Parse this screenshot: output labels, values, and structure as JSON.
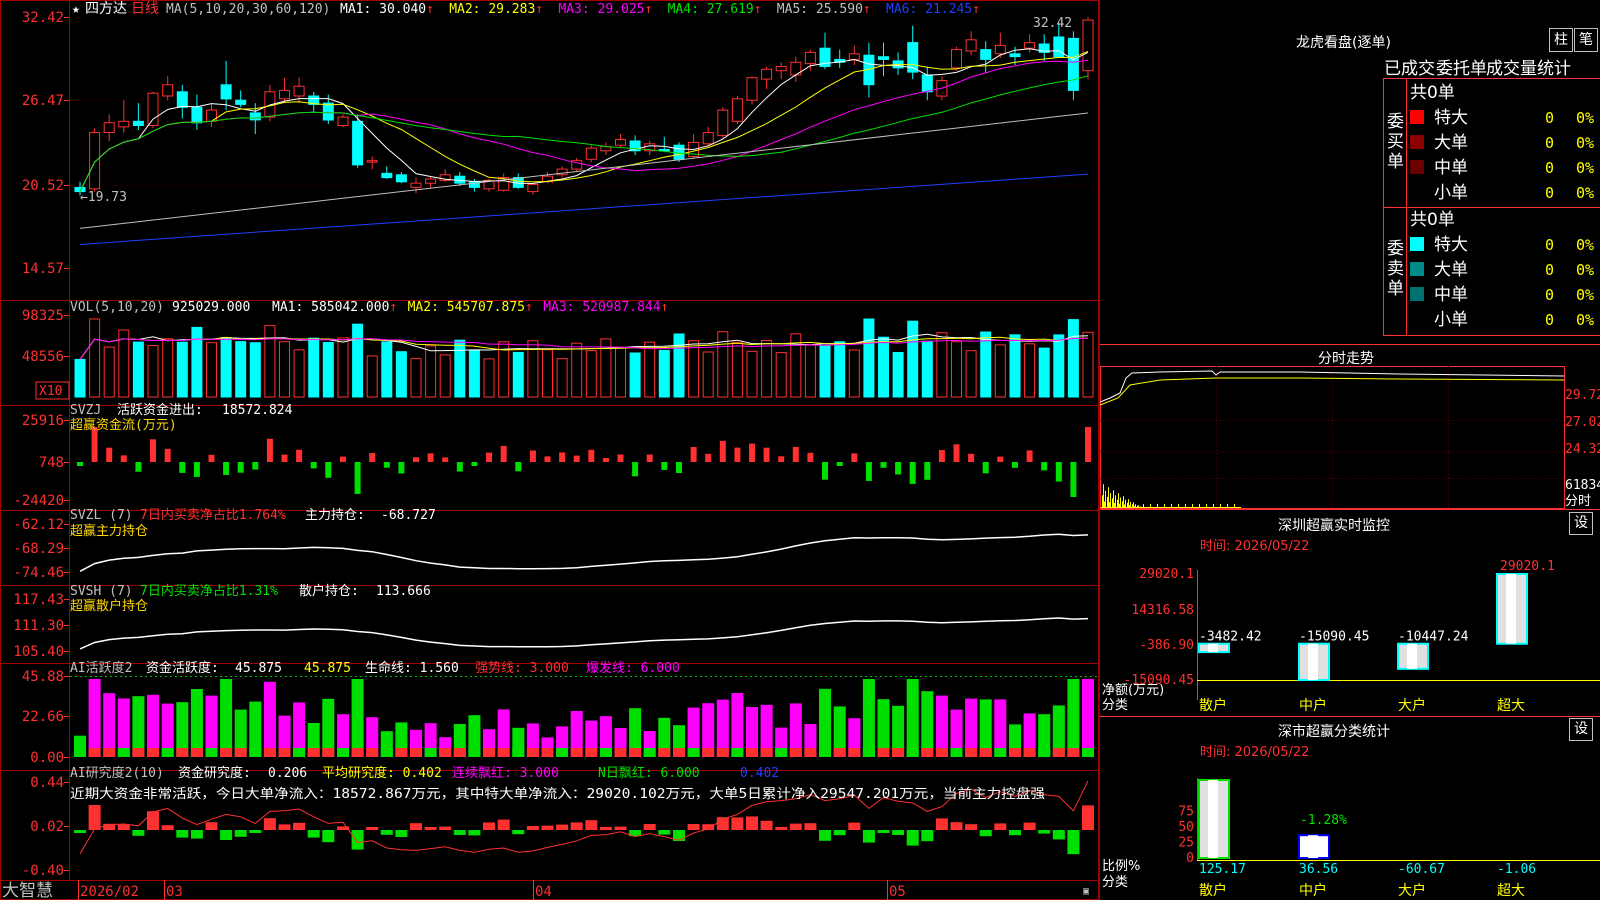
{
  "app": {
    "logo": "大智慧"
  },
  "kline": {
    "stock": "四方达",
    "period": "日线",
    "ma_header": "MA(5,10,20,30,60,120)",
    "mas": [
      {
        "label": "MA1:",
        "value": "30.040",
        "color": "#ffffff"
      },
      {
        "label": "MA2:",
        "value": "29.283",
        "color": "#ffff00"
      },
      {
        "label": "MA3:",
        "value": "29.025",
        "color": "#ff00ff"
      },
      {
        "label": "MA4:",
        "value": "27.619",
        "color": "#00e000"
      },
      {
        "label": "MA5:",
        "value": "25.590",
        "color": "#c0c0c0"
      },
      {
        "label": "MA6:",
        "value": "21.245",
        "color": "#2040ff"
      }
    ],
    "y_ticks": [
      "32.42",
      "26.47",
      "20.52",
      "14.57"
    ],
    "high_label": "32.42",
    "low_label": "19.73"
  },
  "vol": {
    "header": "VOL(5,10,20)",
    "value": "925029.000",
    "mas": [
      {
        "label": "MA1:",
        "value": "585042.000",
        "color": "#ffffff"
      },
      {
        "label": "MA2:",
        "value": "545707.875",
        "color": "#ffff00"
      },
      {
        "label": "MA3:",
        "value": "520987.844",
        "color": "#ff00ff"
      }
    ],
    "y_ticks": [
      "98325",
      "48556"
    ],
    "unit": "X10"
  },
  "svzj": {
    "name": "SVZJ",
    "label": "活跃资金进出:",
    "value": "18572.824",
    "subtitle": "超赢资金流(万元)",
    "y_ticks": [
      "25916",
      "748",
      "-24420"
    ]
  },
  "svzl": {
    "name": "SVZL",
    "param": "(7)",
    "ratio": "7日内买卖净占比1.764%",
    "label": "主力持仓:",
    "value": "-68.727",
    "subtitle": "超赢主力持仓",
    "y_ticks": [
      "-62.12",
      "-68.29",
      "-74.46"
    ]
  },
  "svsh": {
    "name": "SVSH",
    "param": "(7)",
    "ratio": "7日内买卖净占比1.31%",
    "label": "散户持仓:",
    "value": "113.666",
    "subtitle": "超赢散户持仓",
    "y_ticks": [
      "117.43",
      "111.30",
      "105.40"
    ]
  },
  "ai1": {
    "header": "AI活跃度2",
    "label": "资金活跃度:",
    "value": "45.875",
    "value2": "45.875",
    "life": "生命线: 1.560",
    "strong": "强势线: 3.000",
    "burst": "爆发线: 6.000",
    "y_ticks": [
      "45.88",
      "22.66",
      "0.00"
    ]
  },
  "ai2": {
    "header": "AI研究度2(10)",
    "label": "资金研究度:",
    "value": "0.206",
    "avg": "平均研究度: 0.402",
    "cont": "连续飘红: 3.000",
    "nday": "N日飘红: 6.000",
    "last": "0.402",
    "note": "近期大资金非常活跃，今日大单净流入：18572.867万元，其中特大单净流入：29020.102万元，大单5日累计净入29547.201万元，当前主力控盘强",
    "y_ticks": [
      "0.44",
      "0.02",
      "-0.40"
    ]
  },
  "x_axis": {
    "labels": [
      "2026/02",
      "03",
      "04",
      "05"
    ]
  },
  "chart_data": {
    "type": "candlestick",
    "price_range": [
      14.57,
      32.42
    ],
    "candles": [
      {
        "o": 20.3,
        "h": 20.7,
        "l": 19.73,
        "c": 20.0
      },
      {
        "o": 20.2,
        "h": 24.5,
        "l": 20.0,
        "c": 24.2
      },
      {
        "o": 24.2,
        "h": 25.5,
        "l": 23.6,
        "c": 24.9
      },
      {
        "o": 24.6,
        "h": 26.5,
        "l": 24.2,
        "c": 25.0
      },
      {
        "o": 25.0,
        "h": 26.3,
        "l": 24.4,
        "c": 24.7
      },
      {
        "o": 24.7,
        "h": 27.1,
        "l": 24.5,
        "c": 27.0
      },
      {
        "o": 26.8,
        "h": 28.2,
        "l": 26.5,
        "c": 27.6
      },
      {
        "o": 27.1,
        "h": 27.6,
        "l": 25.2,
        "c": 26.0
      },
      {
        "o": 26.0,
        "h": 26.9,
        "l": 24.4,
        "c": 24.9
      },
      {
        "o": 25.0,
        "h": 26.3,
        "l": 24.6,
        "c": 25.8
      },
      {
        "o": 27.6,
        "h": 29.3,
        "l": 25.8,
        "c": 26.6
      },
      {
        "o": 26.5,
        "h": 27.2,
        "l": 26.0,
        "c": 26.2
      },
      {
        "o": 25.6,
        "h": 26.3,
        "l": 24.1,
        "c": 25.1
      },
      {
        "o": 25.3,
        "h": 27.6,
        "l": 25.0,
        "c": 27.1
      },
      {
        "o": 26.6,
        "h": 28.1,
        "l": 26.4,
        "c": 27.2
      },
      {
        "o": 26.8,
        "h": 28.1,
        "l": 26.3,
        "c": 27.5
      },
      {
        "o": 26.8,
        "h": 27.1,
        "l": 25.6,
        "c": 26.2
      },
      {
        "o": 26.3,
        "h": 26.9,
        "l": 24.8,
        "c": 25.1
      },
      {
        "o": 24.7,
        "h": 25.5,
        "l": 24.6,
        "c": 25.3
      },
      {
        "o": 25.0,
        "h": 25.5,
        "l": 21.7,
        "c": 21.9
      },
      {
        "o": 22.1,
        "h": 22.5,
        "l": 21.6,
        "c": 22.2
      },
      {
        "o": 21.3,
        "h": 21.8,
        "l": 20.9,
        "c": 21.0
      },
      {
        "o": 21.2,
        "h": 21.4,
        "l": 20.6,
        "c": 20.7
      },
      {
        "o": 20.3,
        "h": 21.0,
        "l": 19.9,
        "c": 20.6
      },
      {
        "o": 20.6,
        "h": 21.1,
        "l": 20.2,
        "c": 20.9
      },
      {
        "o": 20.8,
        "h": 21.6,
        "l": 20.7,
        "c": 21.2
      },
      {
        "o": 21.1,
        "h": 21.4,
        "l": 20.4,
        "c": 20.6
      },
      {
        "o": 20.7,
        "h": 20.9,
        "l": 20.0,
        "c": 20.3
      },
      {
        "o": 20.2,
        "h": 20.9,
        "l": 20.0,
        "c": 20.8
      },
      {
        "o": 20.1,
        "h": 21.3,
        "l": 20.0,
        "c": 21.0
      },
      {
        "o": 21.0,
        "h": 21.3,
        "l": 20.2,
        "c": 20.3
      },
      {
        "o": 20.0,
        "h": 20.6,
        "l": 19.8,
        "c": 20.5
      },
      {
        "o": 20.7,
        "h": 21.4,
        "l": 20.6,
        "c": 21.1
      },
      {
        "o": 21.2,
        "h": 21.8,
        "l": 21.0,
        "c": 21.6
      },
      {
        "o": 21.6,
        "h": 22.4,
        "l": 21.4,
        "c": 22.2
      },
      {
        "o": 22.3,
        "h": 23.3,
        "l": 22.1,
        "c": 23.1
      },
      {
        "o": 22.9,
        "h": 23.5,
        "l": 22.6,
        "c": 23.2
      },
      {
        "o": 23.3,
        "h": 24.1,
        "l": 23.1,
        "c": 23.7
      },
      {
        "o": 23.6,
        "h": 24.0,
        "l": 22.6,
        "c": 22.9
      },
      {
        "o": 22.9,
        "h": 23.6,
        "l": 22.6,
        "c": 23.4
      },
      {
        "o": 23.0,
        "h": 23.9,
        "l": 22.8,
        "c": 22.9
      },
      {
        "o": 23.3,
        "h": 23.5,
        "l": 22.1,
        "c": 22.3
      },
      {
        "o": 22.5,
        "h": 24.1,
        "l": 22.4,
        "c": 23.5
      },
      {
        "o": 23.4,
        "h": 24.6,
        "l": 23.2,
        "c": 24.2
      },
      {
        "o": 24.0,
        "h": 26.0,
        "l": 23.8,
        "c": 25.8
      },
      {
        "o": 25.0,
        "h": 26.8,
        "l": 24.8,
        "c": 26.6
      },
      {
        "o": 26.5,
        "h": 28.2,
        "l": 26.2,
        "c": 28.1
      },
      {
        "o": 28.0,
        "h": 28.9,
        "l": 27.3,
        "c": 28.7
      },
      {
        "o": 28.6,
        "h": 29.2,
        "l": 28.0,
        "c": 28.9
      },
      {
        "o": 28.3,
        "h": 29.6,
        "l": 27.8,
        "c": 29.2
      },
      {
        "o": 29.1,
        "h": 30.1,
        "l": 28.6,
        "c": 29.9
      },
      {
        "o": 30.2,
        "h": 31.3,
        "l": 28.7,
        "c": 28.9
      },
      {
        "o": 29.4,
        "h": 30.1,
        "l": 28.8,
        "c": 29.2
      },
      {
        "o": 29.4,
        "h": 30.4,
        "l": 29.0,
        "c": 29.8
      },
      {
        "o": 29.7,
        "h": 30.6,
        "l": 26.7,
        "c": 27.6
      },
      {
        "o": 29.6,
        "h": 30.6,
        "l": 28.2,
        "c": 29.4
      },
      {
        "o": 29.3,
        "h": 29.9,
        "l": 28.3,
        "c": 28.8
      },
      {
        "o": 30.6,
        "h": 31.8,
        "l": 28.0,
        "c": 28.5
      },
      {
        "o": 28.3,
        "h": 28.9,
        "l": 26.5,
        "c": 27.1
      },
      {
        "o": 26.8,
        "h": 28.2,
        "l": 26.5,
        "c": 27.9
      },
      {
        "o": 28.8,
        "h": 30.3,
        "l": 28.6,
        "c": 30.1
      },
      {
        "o": 30.0,
        "h": 31.4,
        "l": 29.7,
        "c": 30.8
      },
      {
        "o": 30.1,
        "h": 30.7,
        "l": 28.4,
        "c": 29.4
      },
      {
        "o": 29.8,
        "h": 31.3,
        "l": 29.5,
        "c": 30.4
      },
      {
        "o": 29.8,
        "h": 30.3,
        "l": 29.0,
        "c": 29.6
      },
      {
        "o": 30.2,
        "h": 31.2,
        "l": 29.9,
        "c": 30.6
      },
      {
        "o": 30.5,
        "h": 31.2,
        "l": 29.3,
        "c": 29.9
      },
      {
        "o": 31.0,
        "h": 32.0,
        "l": 30.2,
        "c": 29.6
      },
      {
        "o": 30.9,
        "h": 31.4,
        "l": 26.5,
        "c": 27.2
      },
      {
        "o": 28.6,
        "h": 32.42,
        "l": 28.0,
        "c": 32.2
      }
    ]
  },
  "right": {
    "dragon": {
      "title": "龙虎看盘(逐单)",
      "btns": [
        "柱",
        "笔"
      ],
      "tabs": [
        "已成交",
        "委托单",
        "成交量统计"
      ],
      "buy_group": "委买单",
      "sell_group": "委卖单",
      "buy_total": "共0单",
      "sell_total": "共0单",
      "buy_rows": [
        {
          "label": "特大",
          "count": "0",
          "pct": "0%",
          "color": "#ff0000"
        },
        {
          "label": "大单",
          "count": "0",
          "pct": "0%",
          "color": "#8b0000"
        },
        {
          "label": "中单",
          "count": "0",
          "pct": "0%",
          "color": "#6b0000"
        },
        {
          "label": "小单",
          "count": "0",
          "pct": "0%",
          "color": ""
        }
      ],
      "sell_rows": [
        {
          "label": "特大",
          "count": "0",
          "pct": "0%",
          "color": "#00ffff"
        },
        {
          "label": "大单",
          "count": "0",
          "pct": "0%",
          "color": "#008b8b"
        },
        {
          "label": "中单",
          "count": "0",
          "pct": "0%",
          "color": "#007070"
        },
        {
          "label": "小单",
          "count": "0",
          "pct": "0%",
          "color": ""
        }
      ]
    },
    "intraday": {
      "title": "分时走势",
      "y_ticks": [
        "29.72",
        "27.02",
        "24.32"
      ],
      "vol_tick": "61834",
      "unit": "分时"
    },
    "monitor": {
      "title": "深圳超赢实时监控",
      "btn": "设",
      "time": "时间: 2026/05/22",
      "y_ticks": [
        "29020.1",
        "14316.58",
        "-386.90",
        "-15090.45"
      ],
      "ylabel": "净额(万元)",
      "xtitle": "分类",
      "top_label": "29020.1",
      "bars": [
        {
          "cat": "散户",
          "value": -3482.42,
          "label": "-3482.42"
        },
        {
          "cat": "中户",
          "value": -15090.45,
          "label": "-15090.45"
        },
        {
          "cat": "大户",
          "value": -10447.24,
          "label": "-10447.24"
        },
        {
          "cat": "超大",
          "value": 29020.1,
          "label": ""
        }
      ]
    },
    "classify": {
      "title": "深市超赢分类统计",
      "btn": "设",
      "time": "时间: 2026/05/22",
      "y_ticks": [
        "75",
        "50",
        "25",
        "0"
      ],
      "ylabel": "比例%",
      "xtitle": "分类",
      "float_label": "-1.28%",
      "bars": [
        {
          "cat": "散户",
          "value": 125.17,
          "label": "125.17"
        },
        {
          "cat": "中户",
          "value": 36.56,
          "label": "36.56"
        },
        {
          "cat": "大户",
          "value": -60.67,
          "label": "-60.67"
        },
        {
          "cat": "超大",
          "value": -1.06,
          "label": "-1.06"
        }
      ]
    }
  }
}
